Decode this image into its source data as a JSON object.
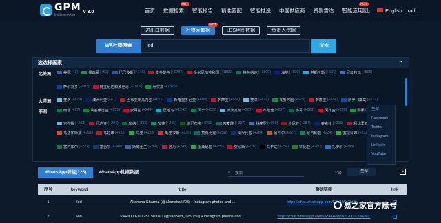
{
  "brand": {
    "name": "GPM",
    "subtitle": "tradessn.com",
    "version": "v 3.0"
  },
  "nav": {
    "items": [
      "首页",
      "数据搜索",
      "智能报告",
      "精准匹配",
      "智能推送",
      "中国供应商",
      "贸易雷达",
      "智能应用"
    ],
    "hot_label": "HOT",
    "exit_label": "退出",
    "language": "English",
    "user": "trad..."
  },
  "tabs": [
    {
      "label": "进出口数据",
      "active": false
    },
    {
      "label": "社媒大数据",
      "active": true
    },
    {
      "label": "LBS地图数据",
      "active": false
    },
    {
      "label": "负责人挖掘",
      "active": false
    }
  ],
  "search": {
    "type": "WA社媒搜索",
    "value": "led",
    "button": "搜索"
  },
  "country_panel": {
    "title": "选选择国家",
    "regions": [
      {
        "name": "北美洲",
        "countries": [
          {
            "name": "美国",
            "count": "(+2)",
            "color": "#3b5ca8"
          },
          {
            "name": "墨西哥",
            "count": "(+62)",
            "color": "#2e8b57"
          },
          {
            "name": "巴巴多斯",
            "count": "(+146)",
            "color": "#2c5aa0"
          },
          {
            "name": "波多黎各",
            "count": "(+1787)",
            "color": "#c8102e"
          },
          {
            "name": "多米尼加共和国",
            "count": "(+1890)",
            "color": "#ce1126"
          },
          {
            "name": "格林纳达",
            "count": "(+1809)",
            "color": "#007a5e"
          },
          {
            "name": "海地",
            "count": "(+509)",
            "color": "#00209f"
          },
          {
            "name": "洪都拉斯",
            "count": "(+504)",
            "color": "#00bce4"
          },
          {
            "name": "尼加拉瓜",
            "count": "(+505)",
            "color": "#3a75c4"
          }
        ]
      },
      {
        "name": "",
        "countries": [
          {
            "name": "萨尔瓦多",
            "count": "(+503)",
            "color": "#0047ab"
          },
          {
            "name": "特立尼达和多巴哥",
            "count": "(+1809)",
            "color": "#ce1126"
          },
          {
            "name": "牙买加",
            "count": "(+1876)",
            "color": "#009b3a"
          }
        ]
      },
      {
        "name": "大洋洲",
        "countries": [
          {
            "name": "斐济",
            "count": "(+679)",
            "color": "#68bfe5"
          },
          {
            "name": "澳大利亚",
            "count": "(+61)",
            "color": "#012169"
          },
          {
            "name": "巴布亚新几内亚",
            "count": "(+675)",
            "color": "#ce1126"
          },
          {
            "name": "新喀里多尼亚",
            "count": "(+689)",
            "color": "#0035ad"
          },
          {
            "name": "萨摩亚",
            "count": "(+684)",
            "color": "#ce1126"
          },
          {
            "name": "斐济",
            "count": "(+679)",
            "color": "#68bfe5"
          },
          {
            "name": "瓦努阿图",
            "count": "(+678)",
            "color": "#009543"
          },
          {
            "name": "萨摩亚",
            "count": "(+684)",
            "color": "#ce1126"
          },
          {
            "name": "所罗门群岛",
            "count": "(+677)",
            "color": "#0051ba"
          }
        ]
      },
      {
        "name": "非洲",
        "countries": [
          {
            "name": "南非",
            "count": "(+27)",
            "color": "#007a4d"
          },
          {
            "name": "埃塞俄比亚",
            "count": "(+251)",
            "color": "#078930"
          },
          {
            "name": "安哥拉",
            "count": "(+244)",
            "color": "#cc092f"
          },
          {
            "name": "巴哈马",
            "count": "(+1242)",
            "color": "#00abc9"
          },
          {
            "name": "贝宁",
            "count": "(+229)",
            "color": "#008751"
          },
          {
            "name": "博茨瓦纳",
            "count": "(+267)",
            "color": "#75aadb"
          },
          {
            "name": "布隆迪",
            "count": "(+257)",
            "color": "#ce1126"
          },
          {
            "name": "多哥",
            "count": "(+228)",
            "color": "#006a4e"
          },
          {
            "name": "冈比亚",
            "count": "(+220)",
            "color": "#ce1126"
          },
          {
            "name": "刚果",
            "count": "(+242)",
            "color": "#009543"
          }
        ]
      },
      {
        "name": "",
        "countries": [
          {
            "name": "吉布提",
            "count": "(+253)",
            "color": "#6ab2e7"
          },
          {
            "name": "几内亚",
            "count": "(+224)",
            "color": "#ce1126"
          },
          {
            "name": "加纳",
            "count": "(+233)",
            "color": "#006b3f"
          },
          {
            "name": "加蓬",
            "count": "(+241)",
            "color": "#009e60"
          },
          {
            "name": "津巴布韦",
            "count": "(+263)",
            "color": "#006400"
          },
          {
            "name": "喀麦隆",
            "count": "(+237)",
            "color": "#007a5e"
          },
          {
            "name": "科摩罗",
            "count": "(+269)",
            "color": "#3a75c4"
          },
          {
            "name": "肯尼亚",
            "count": "(+254)",
            "color": "#bb0000"
          },
          {
            "name": "莱索托",
            "count": "(+266)",
            "color": "#00209f"
          },
          {
            "name": "利比里亚",
            "count": "(+231)",
            "color": "#bf0a30"
          }
        ]
      },
      {
        "name": "",
        "countries": [
          {
            "name": "马达加斯加",
            "count": "(+261)",
            "color": "#fc3d32"
          },
          {
            "name": "马拉维",
            "count": "(+265)",
            "color": "#ce1126"
          },
          {
            "name": "马里",
            "count": "(+223)",
            "color": "#14b53a"
          },
          {
            "name": "毛里求斯",
            "count": "(+230)",
            "color": "#ea2839"
          },
          {
            "name": "莫桑比克",
            "count": "(+258)",
            "color": "#007168"
          },
          {
            "name": "纳米比亚",
            "count": "(+264)",
            "color": "#003580"
          },
          {
            "name": "尼日尔",
            "count": "(+227)",
            "color": "#e05206"
          },
          {
            "name": "尼日利亚",
            "count": "(+234)",
            "color": "#008751"
          },
          {
            "name": "塞拉利昂",
            "count": "(+232)",
            "color": "#1eb53a"
          }
        ]
      },
      {
        "name": "",
        "countries": [
          {
            "name": "塞内加尔",
            "count": "(+221)",
            "color": "#00853f"
          },
          {
            "name": "塞舌尔",
            "count": "(+248)",
            "color": "#003f87"
          },
          {
            "name": "斯威士兰",
            "count": "(+268)",
            "color": "#3e5eb9"
          },
          {
            "name": "苏丹",
            "count": "(+249)",
            "color": "#d21034"
          },
          {
            "name": "坦桑尼亚",
            "count": "(+255)",
            "color": "#1eb53a"
          },
          {
            "name": "突尼斯",
            "count": "(+216)",
            "color": "#e70013"
          },
          {
            "name": "乌干达",
            "count": "(+256)",
            "color": "#000000"
          },
          {
            "name": "赞比亚",
            "count": "(+260)",
            "color": "#198a00"
          },
          {
            "name": "扎伊尔",
            "count": "(+243)",
            "color": "#007fff"
          }
        ]
      }
    ]
  },
  "share_menu": [
    "全部",
    "Facebook",
    "Twitter",
    "Instagram",
    "Linkedin",
    "YouTube"
  ],
  "results": {
    "tabs": [
      "WhatsApp群组(126)",
      "WhatsApp社媒数据"
    ],
    "search_placeholder": "搜索",
    "platform_label": "平台",
    "platform_value": "全部",
    "columns": [
      "序号",
      "keyword",
      "title",
      "群组链接",
      "link"
    ],
    "rows": [
      {
        "index": "1",
        "keyword": "led",
        "title": "Akansha Sharma (@akansha5703) • Instagram photos and ...",
        "url": "https://chat.whatsapp.com/F5b3iWy2bOw..."
      },
      {
        "index": "2",
        "keyword": "led",
        "title": "VARIO LED 125/150 IND (@varioled_125.150) • Instagram photos and ...",
        "url": "https://chat.whatsapp.com/LRa4HkdpN2GQ1ChNENC"
      }
    ]
  },
  "watermark": "易之家官方账号"
}
